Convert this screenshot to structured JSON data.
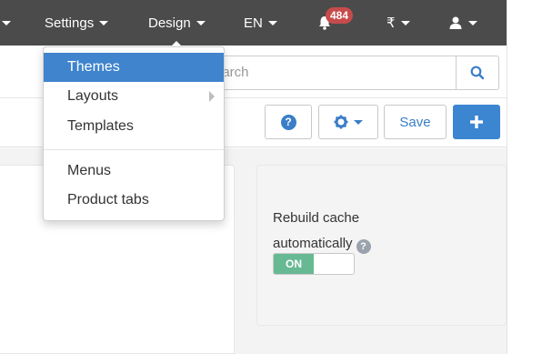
{
  "nav": {
    "settings_label": "Settings",
    "design_label": "Design",
    "language_label": "EN",
    "notifications_count": "484",
    "currency_label": "₹"
  },
  "search": {
    "placeholder": "earch"
  },
  "toolbar": {
    "help_label": "?",
    "save_label": "Save",
    "add_label": "+"
  },
  "design_menu": {
    "items": [
      {
        "label": "Themes",
        "selected": true
      },
      {
        "label": "Layouts",
        "has_submenu": true
      },
      {
        "label": "Templates"
      },
      {
        "label": "Menus"
      },
      {
        "label": "Product tabs"
      }
    ]
  },
  "cache_panel": {
    "label": "Rebuild cache automatically",
    "help_label": "?",
    "toggle_label": "ON",
    "toggle_state": true
  },
  "colors": {
    "topbar": "#4b4b4b",
    "accent_blue": "#3c85d0",
    "selected_item": "#3f84cc",
    "badge_red": "#c74b4b",
    "toggle_green": "#67b994"
  }
}
